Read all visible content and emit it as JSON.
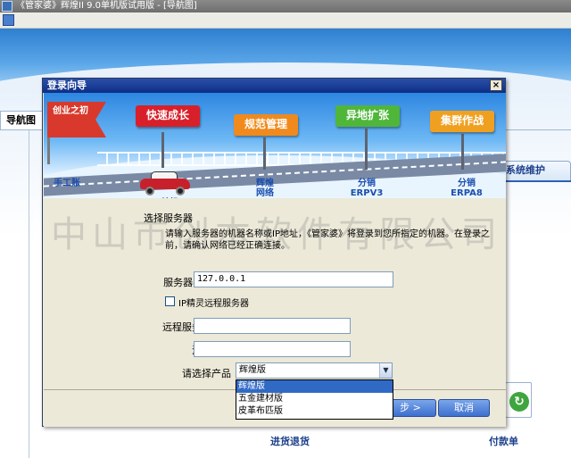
{
  "app": {
    "title": "《管家婆》辉煌II 9.0单机版试用版 - [导航图]",
    "nav_tab": "导航图",
    "sys_tab": "系统维护",
    "bottom_left_label": "进货退货",
    "bottom_right_label": "付款单"
  },
  "dialog": {
    "title": "登录向导",
    "close": "×",
    "banner": {
      "flag": "创业之初",
      "stages": [
        "快速成长",
        "规范管理",
        "异地扩张",
        "集群作战"
      ],
      "milestones": [
        "手工账",
        "单机",
        "辉煌\n网络",
        "分销\nERPV3",
        "分销\nERPA8"
      ]
    },
    "watermark": "中山市创本软件有限公司",
    "section_title": "选择服务器",
    "description": "请输入服务器的机器名称或IP地址，《管家婆》将登录到您所指定的机器。在登录之前，请确认网络已经正确连接。",
    "server_label": "服务器名称或IP",
    "server_value": "127.0.0.1",
    "remote_checkbox_label": "IP精灵远程服务器",
    "remote_checkbox_checked": false,
    "alias_label": "远程服务器别名",
    "alias_value": "",
    "reg_label": "注册密码",
    "reg_value": "",
    "product_label": "请选择产品",
    "product_value": "辉煌版",
    "product_options": [
      "辉煌版",
      "五金建材版",
      "皮革布匹版"
    ],
    "product_highlighted": "辉煌版",
    "next_label": "步 >",
    "cancel_label": "取消"
  }
}
